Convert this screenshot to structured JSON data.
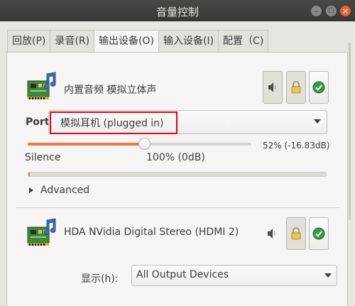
{
  "window": {
    "title": "音量控制"
  },
  "tabs": [
    {
      "label": "回放(P)"
    },
    {
      "label": "录音(R)"
    },
    {
      "label": "输出设备(O)"
    },
    {
      "label": "输入设备(I)"
    },
    {
      "label": "配置（C)"
    }
  ],
  "active_tab_index": 2,
  "devices": [
    {
      "name": "内置音频 模拟立体声",
      "port_label": "Port",
      "port_value": "模拟耳机 (plugged in)",
      "volume_readout": "52% (-16.83dB)",
      "volume_level": 0.52,
      "mark_silence": "Silence",
      "mark_100": "100% (0dB)",
      "peak_level": 0.0,
      "advanced_label": "Advanced"
    },
    {
      "name": "HDA NVidia Digital Stereo (HDMI 2)"
    }
  ],
  "show": {
    "label": "显示(h):",
    "value": "All Output Devices"
  },
  "colors": {
    "accent": "#e97950",
    "highlight": "#e8001c",
    "titlebar": "#3f3d3a",
    "default_check": "#2f9c4a"
  },
  "icons": {
    "device": "sound-card-icon",
    "mute": "speaker-icon",
    "lock": "lock-icon",
    "default": "check-circle-icon"
  }
}
